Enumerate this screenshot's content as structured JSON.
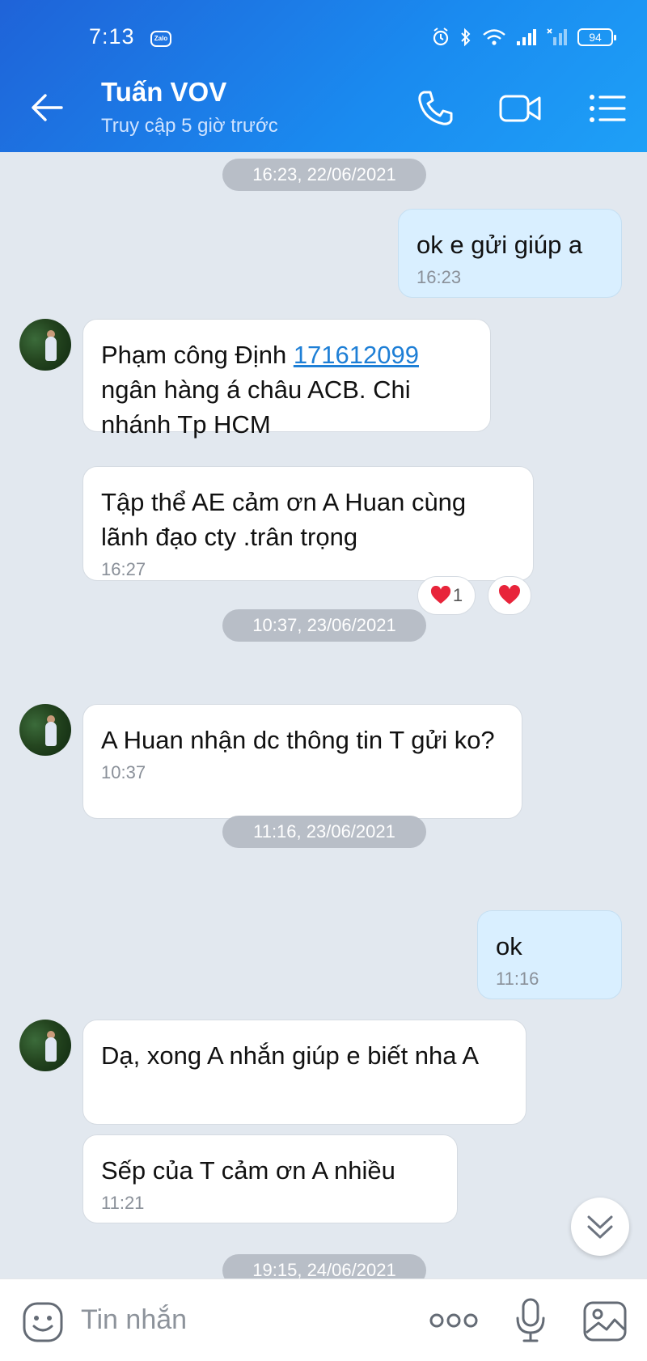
{
  "status_bar": {
    "time": "7:13",
    "app_badge": "Zalo",
    "battery": "94"
  },
  "header": {
    "contact_name": "Tuấn VOV",
    "contact_status": "Truy cập 5 giờ trước"
  },
  "conversation": {
    "dates": [
      "16:23, 22/06/2021",
      "10:37, 23/06/2021",
      "11:16, 23/06/2021",
      "19:15, 24/06/2021"
    ],
    "messages": [
      {
        "text": "ok e gửi giúp a",
        "time": "16:23"
      },
      {
        "text_before": "Phạm công Định ",
        "link": "171612099",
        "text_after": "ngân hàng á châu ACB. Chi nhánh Tp HCM"
      },
      {
        "text": "Tập thể AE cảm ơn A Huan cùng lãnh đạo cty .trân trọng",
        "time": "16:27",
        "reaction_count": "1"
      },
      {
        "text": "A Huan nhận dc thông tin T gửi ko?",
        "time": "10:37"
      },
      {
        "text": "ok",
        "time": "11:16"
      },
      {
        "text": "Dạ, xong A nhắn giúp e biết nha A"
      },
      {
        "text": "Sếp của T cảm ơn A nhiều",
        "time": "11:21"
      }
    ]
  },
  "input": {
    "placeholder": "Tin nhắn"
  },
  "colors": {
    "header": "#1a8bf0",
    "outgoing_bubble": "#d9efff",
    "incoming_bubble": "#ffffff",
    "background": "#e2e8ef",
    "heart": "#e8243a"
  },
  "icons": [
    "back-arrow-icon",
    "phone-icon",
    "video-call-icon",
    "menu-list-icon",
    "alarm-icon",
    "bluetooth-icon",
    "wifi-icon",
    "signal-icon",
    "heart-icon",
    "chevron-double-down-icon",
    "emoji-icon",
    "more-dots-icon",
    "microphone-icon",
    "image-icon"
  ]
}
